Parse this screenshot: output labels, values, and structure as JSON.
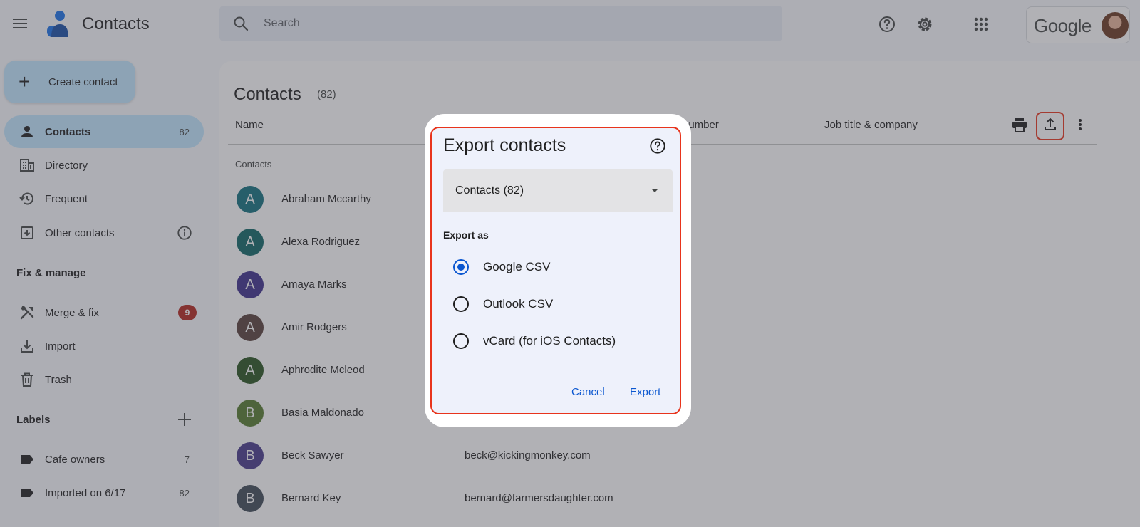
{
  "app": {
    "title": "Contacts"
  },
  "search": {
    "placeholder": "Search"
  },
  "account": {
    "brand": "Google"
  },
  "sidebar": {
    "create_label": "Create contact",
    "items": [
      {
        "label": "Contacts",
        "count": "82",
        "icon": "person-icon",
        "active": true
      },
      {
        "label": "Directory",
        "count": "",
        "icon": "building-icon"
      },
      {
        "label": "Frequent",
        "count": "",
        "icon": "history-icon"
      },
      {
        "label": "Other contacts",
        "count": "",
        "icon": "archive-icon"
      }
    ],
    "fix_manage_title": "Fix & manage",
    "fix_items": [
      {
        "label": "Merge & fix",
        "badge": "9",
        "icon": "merge-fix-icon"
      },
      {
        "label": "Import",
        "icon": "import-icon"
      },
      {
        "label": "Trash",
        "icon": "trash-icon"
      }
    ],
    "labels_title": "Labels",
    "labels": [
      {
        "label": "Cafe owners",
        "count": "7"
      },
      {
        "label": "Imported on 6/17",
        "count": "82"
      }
    ]
  },
  "main": {
    "title": "Contacts",
    "count": "(82)",
    "columns": {
      "name": "Name",
      "phone": "number",
      "job": "Job title & company"
    },
    "section_label": "Contacts",
    "contacts": [
      {
        "initial": "A",
        "name": "Abraham Mccarthy",
        "email": "",
        "color": "#12707f"
      },
      {
        "initial": "A",
        "name": "Alexa Rodriguez",
        "email": "",
        "color": "#0f6766"
      },
      {
        "initial": "A",
        "name": "Amaya Marks",
        "email": "",
        "color": "#3d2f8c"
      },
      {
        "initial": "A",
        "name": "Amir Rodgers",
        "email": "",
        "color": "#59413b"
      },
      {
        "initial": "A",
        "name": "Aphrodite Mcleod",
        "email": "",
        "color": "#28541f"
      },
      {
        "initial": "B",
        "name": "Basia Maldonado",
        "email": "",
        "color": "#557b2d"
      },
      {
        "initial": "B",
        "name": "Beck Sawyer",
        "email": "beck@kickingmonkey.com",
        "color": "#473a8a"
      },
      {
        "initial": "B",
        "name": "Bernard Key",
        "email": "bernard@farmersdaughter.com",
        "color": "#3e4a57"
      }
    ]
  },
  "dialog": {
    "title": "Export contacts",
    "select_value": "Contacts (82)",
    "export_as_label": "Export as",
    "options": [
      {
        "label": "Google CSV",
        "checked": true
      },
      {
        "label": "Outlook CSV",
        "checked": false
      },
      {
        "label": "vCard (for iOS Contacts)",
        "checked": false
      }
    ],
    "cancel_label": "Cancel",
    "export_label": "Export"
  },
  "colors": {
    "accent": "#0b57d0",
    "highlight": "#e8341c",
    "nav_active": "#c2e7ff",
    "badge": "#b3261e"
  }
}
